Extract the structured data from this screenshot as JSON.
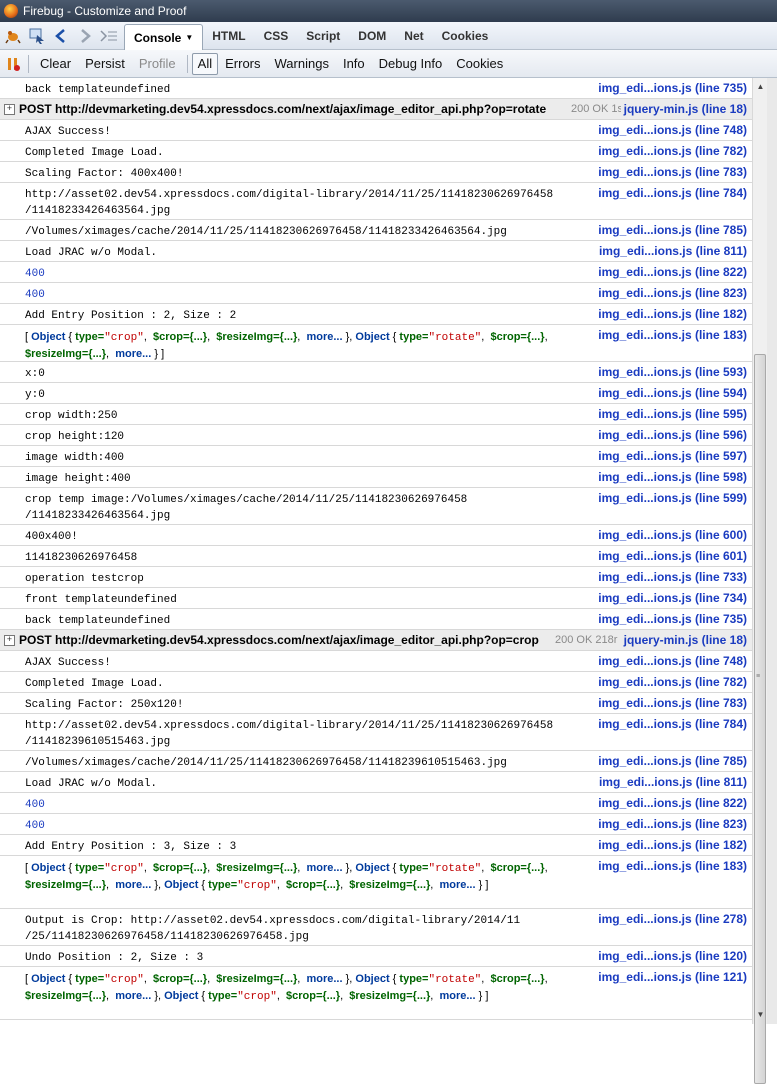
{
  "window": {
    "title": "Firebug - Customize and Proof"
  },
  "toolbar": {
    "tabs": [
      {
        "label": "Console",
        "active": true
      },
      {
        "label": "HTML"
      },
      {
        "label": "CSS"
      },
      {
        "label": "Script"
      },
      {
        "label": "DOM"
      },
      {
        "label": "Net"
      },
      {
        "label": "Cookies"
      }
    ]
  },
  "console_toolbar": {
    "clear": "Clear",
    "persist": "Persist",
    "profile": "Profile",
    "filters": [
      "All",
      "Errors",
      "Warnings",
      "Info",
      "Debug Info",
      "Cookies"
    ]
  },
  "log": [
    {
      "msg": "back templateundefined",
      "src": "img_edi...ions.js (line 735)"
    },
    {
      "net": true,
      "req": "POST http://devmarketing.dev54.xpressdocs.com/next/ajax/image_editor_api.php?op=rotate",
      "status": "200 OK 1s",
      "src": "jquery-min.js (line 18)"
    },
    {
      "msg": "AJAX Success!",
      "src": "img_edi...ions.js (line 748)"
    },
    {
      "msg": "Completed Image Load.",
      "src": "img_edi...ions.js (line 782)"
    },
    {
      "msg": "Scaling Factor: 400x400!",
      "src": "img_edi...ions.js (line 783)"
    },
    {
      "msg": "http://asset02.dev54.xpressdocs.com/digital-library/2014/11/25/11418230626976458\n/11418233426463564.jpg",
      "src": "img_edi...ions.js (line 784)"
    },
    {
      "msg": "/Volumes/ximages/cache/2014/11/25/11418230626976458/11418233426463564.jpg",
      "src": "img_edi...ions.js (line 785)"
    },
    {
      "msg": "Load JRAC w/o Modal.",
      "src": "img_edi...ions.js (line 811)"
    },
    {
      "msg": "400",
      "src": "img_edi...ions.js (line 822)",
      "num": true
    },
    {
      "msg": "400",
      "src": "img_edi...ions.js (line 823)",
      "num": true
    },
    {
      "msg": "Add Entry Position : 2, Size : 2",
      "src": "img_edi...ions.js (line 182)"
    },
    {
      "obj": 1,
      "src": "img_edi...ions.js (line 183)"
    },
    {
      "msg": "x:0",
      "src": "img_edi...ions.js (line 593)"
    },
    {
      "msg": "y:0",
      "src": "img_edi...ions.js (line 594)"
    },
    {
      "msg": "crop width:250",
      "src": "img_edi...ions.js (line 595)"
    },
    {
      "msg": "crop height:120",
      "src": "img_edi...ions.js (line 596)"
    },
    {
      "msg": "image width:400",
      "src": "img_edi...ions.js (line 597)"
    },
    {
      "msg": "image height:400",
      "src": "img_edi...ions.js (line 598)"
    },
    {
      "msg": "crop temp image:/Volumes/ximages/cache/2014/11/25/11418230626976458\n/11418233426463564.jpg",
      "src": "img_edi...ions.js (line 599)"
    },
    {
      "msg": "400x400!",
      "src": "img_edi...ions.js (line 600)"
    },
    {
      "msg": "11418230626976458",
      "src": "img_edi...ions.js (line 601)"
    },
    {
      "msg": "operation testcrop",
      "src": "img_edi...ions.js (line 733)"
    },
    {
      "msg": "front templateundefined",
      "src": "img_edi...ions.js (line 734)"
    },
    {
      "msg": "back templateundefined",
      "src": "img_edi...ions.js (line 735)"
    },
    {
      "net": true,
      "req": "POST http://devmarketing.dev54.xpressdocs.com/next/ajax/image_editor_api.php?op=crop",
      "status": "200 OK 218r",
      "src": "jquery-min.js (line 18)"
    },
    {
      "msg": "AJAX Success!",
      "src": "img_edi...ions.js (line 748)"
    },
    {
      "msg": "Completed Image Load.",
      "src": "img_edi...ions.js (line 782)"
    },
    {
      "msg": "Scaling Factor: 250x120!",
      "src": "img_edi...ions.js (line 783)"
    },
    {
      "msg": "http://asset02.dev54.xpressdocs.com/digital-library/2014/11/25/11418230626976458\n/11418239610515463.jpg",
      "src": "img_edi...ions.js (line 784)"
    },
    {
      "msg": "/Volumes/ximages/cache/2014/11/25/11418230626976458/11418239610515463.jpg",
      "src": "img_edi...ions.js (line 785)"
    },
    {
      "msg": "Load JRAC w/o Modal.",
      "src": "img_edi...ions.js (line 811)"
    },
    {
      "msg": "400",
      "src": "img_edi...ions.js (line 822)",
      "num": true
    },
    {
      "msg": "400",
      "src": "img_edi...ions.js (line 823)",
      "num": true
    },
    {
      "msg": "Add Entry Position : 3, Size : 3",
      "src": "img_edi...ions.js (line 182)"
    },
    {
      "obj": 2,
      "src": "img_edi...ions.js (line 183)"
    },
    {
      "msg": "Output is Crop: http://asset02.dev54.xpressdocs.com/digital-library/2014/11\n/25/11418230626976458/11418230626976458.jpg",
      "src": "img_edi...ions.js (line 278)"
    },
    {
      "msg": "Undo Position : 2, Size : 3",
      "src": "img_edi...ions.js (line 120)"
    },
    {
      "obj": 2,
      "src": "img_edi...ions.js (line 121)"
    }
  ],
  "objects": {
    "type_label": "type=",
    "crop": "\"crop\"",
    "rotate": "\"rotate\"",
    "crop_prop": "$crop={...}",
    "resize_prop": "$resizeImg={...}",
    "more": "more...",
    "object_kw": "Object"
  }
}
